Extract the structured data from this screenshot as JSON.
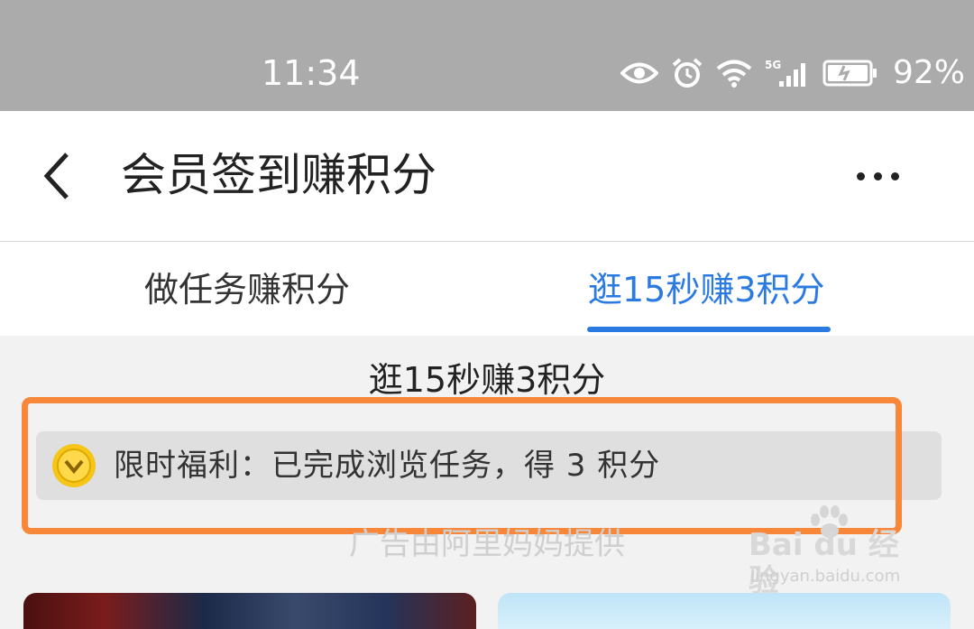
{
  "status_bar": {
    "time": "11:34",
    "battery": "92%",
    "icons": [
      "eye-icon",
      "alarm-icon",
      "wifi-icon",
      "signal-5g-icon",
      "battery-icon"
    ]
  },
  "header": {
    "back_icon": "chevron-left-icon",
    "title": "会员签到赚积分",
    "more_icon": "more-dots-icon"
  },
  "tabs": [
    {
      "label": "做任务赚积分",
      "active": false
    },
    {
      "label": "逛15秒赚3积分",
      "active": true
    }
  ],
  "content": {
    "section_title": "逛15秒赚3积分",
    "benefit": {
      "icon": "gold-coin-icon",
      "text": "限时福利：已完成浏览任务，得 3 积分"
    },
    "ad_provider": "广告由阿里妈妈提供"
  },
  "watermark": {
    "main": "Bai du 经验",
    "sub": "jingyan.baidu.com"
  },
  "colors": {
    "accent": "#2a7ae2",
    "highlight": "#f8873a",
    "status_bar_bg": "#ababab"
  }
}
